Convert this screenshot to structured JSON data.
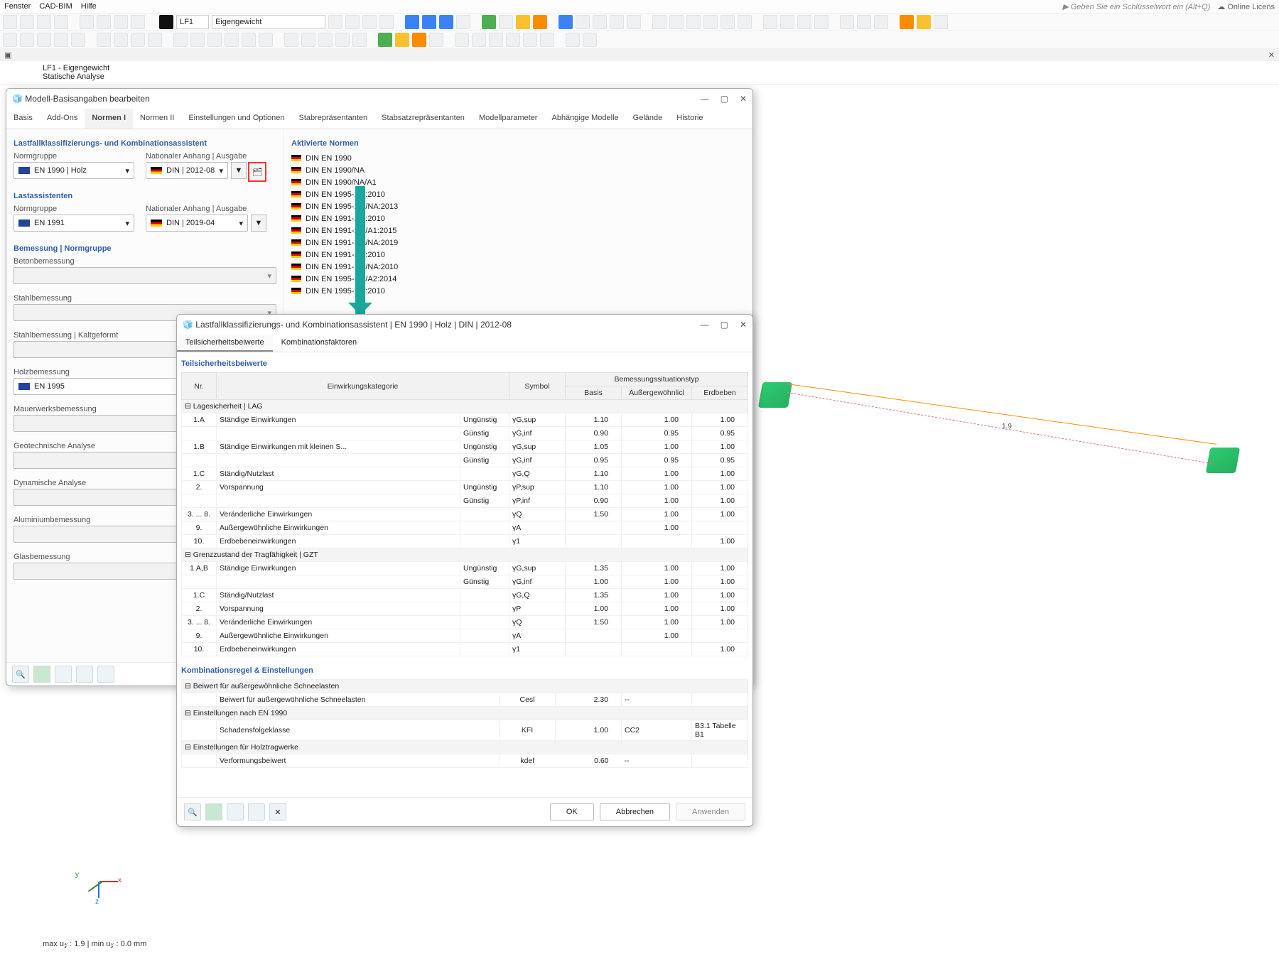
{
  "menu": {
    "items": [
      "Fenster",
      "CAD-BIM",
      "Hilfe"
    ],
    "search_placeholder": "Geben Sie ein Schlüsselwort ein (Alt+Q)",
    "license": "Online Licens"
  },
  "lf": {
    "code": "LF1",
    "name": "Eigengewicht"
  },
  "header": {
    "line1": "LF1 - Eigengewicht",
    "line2": "Statische Analyse"
  },
  "viewport": {
    "dim_label": "1.9",
    "axes": {
      "x": "x",
      "y": "y",
      "z": "z"
    },
    "uz_text": "max u",
    "uz_sub": "z",
    "uz_vals": " : 1.9 | min u",
    " uz_sub2": "z",
    "uz_tail": " : 0.0 mm"
  },
  "dlg1": {
    "title": "Modell-Basisangaben bearbeiten",
    "tabs": [
      "Basis",
      "Add-Ons",
      "Normen I",
      "Normen II",
      "Einstellungen und Optionen",
      "Stabrepräsentanten",
      "Stabsatzrepräsentanten",
      "Modellparameter",
      "Abhängige Modelle",
      "Gelände",
      "Historie"
    ],
    "sect_lk": "Lastfallklassifizierungs- und Kombinationsassistent",
    "lbl_ng": "Normgruppe",
    "lbl_na": "Nationaler Anhang | Ausgabe",
    "ng1": "EN 1990 | Holz",
    "na1": "DIN | 2012-08",
    "sect_la": "Lastassistenten",
    "ng2": "EN 1991",
    "na2": "DIN | 2019-04",
    "sect_bem": "Bemessung | Normgruppe",
    "bem_items": [
      "Betonbemessung",
      "Stahlbemessung",
      "Stahlbemessung | Kaltgeformt",
      "Holzbemessung",
      "Mauerwerksbemessung",
      "Geotechnische Analyse",
      "Dynamische Analyse",
      "Aluminiumbemessung",
      "Glasbemessung"
    ],
    "bem_holz": "EN 1995",
    "sect_norms": "Aktivierte Normen",
    "norms": [
      "DIN EN 1990",
      "DIN EN 1990/NA",
      "DIN EN 1990/NA/A1",
      "DIN EN 1995-1-1:2010",
      "DIN EN 1995-1-1/NA:2013",
      "DIN EN 1991-1-3:2010",
      "DIN EN 1991-1-3/A1:2015",
      "DIN EN 1991-1-3/NA:2019",
      "DIN EN 1991-1-4:2010",
      "DIN EN 1991-1-4/NA:2010",
      "DIN EN 1995-1-1/A2:2014",
      "DIN EN 1995-1-2:2010"
    ]
  },
  "dlg2": {
    "title": "Lastfallklassifizierungs- und Kombinationsassistent | EN 1990 | Holz | DIN | 2012-08",
    "tabs": [
      "Teilsicherheitsbeiwerte",
      "Kombinationsfaktoren"
    ],
    "thdr": "Teilsicherheitsbeiwerte",
    "col": {
      "nr": "Nr.",
      "kat": "Einwirkungskategorie",
      "sym": "Symbol",
      "basis": "Basis",
      "au": "Außergewöhnlicl",
      "eb": "Erdbeben",
      "situ": "Bemessungssituationstyp"
    },
    "grp1": "Lagesicherheit | LAG",
    "rows1": [
      {
        "nr": "1.A",
        "kat": "Ständige Einwirkungen",
        "g": "Ungünstig",
        "sym": "γG,sup",
        "b": "1.10",
        "a": "1.00",
        "e": "1.00"
      },
      {
        "nr": "",
        "kat": "",
        "g": "Günstig",
        "sym": "γG,inf",
        "b": "0.90",
        "a": "0.95",
        "e": "0.95"
      },
      {
        "nr": "1.B",
        "kat": "Ständige Einwirkungen mit kleinen S...",
        "g": "Ungünstig",
        "sym": "γG,sup",
        "b": "1.05",
        "a": "1.00",
        "e": "1.00"
      },
      {
        "nr": "",
        "kat": "",
        "g": "Günstig",
        "sym": "γG,inf",
        "b": "0.95",
        "a": "0.95",
        "e": "0.95"
      },
      {
        "nr": "1.C",
        "kat": "Ständig/Nutzlast",
        "g": "",
        "sym": "γG,Q",
        "b": "1.10",
        "a": "1.00",
        "e": "1.00"
      },
      {
        "nr": "2.",
        "kat": "Vorspannung",
        "g": "Ungünstig",
        "sym": "γP,sup",
        "b": "1.10",
        "a": "1.00",
        "e": "1.00"
      },
      {
        "nr": "",
        "kat": "",
        "g": "Günstig",
        "sym": "γP,inf",
        "b": "0.90",
        "a": "1.00",
        "e": "1.00"
      },
      {
        "nr": "3. ... 8.",
        "kat": "Veränderliche Einwirkungen",
        "g": "",
        "sym": "γQ",
        "b": "1.50",
        "a": "1.00",
        "e": "1.00"
      },
      {
        "nr": "9.",
        "kat": "Außergewöhnliche Einwirkungen",
        "g": "",
        "sym": "γA",
        "b": "",
        "a": "1.00",
        "e": ""
      },
      {
        "nr": "10.",
        "kat": "Erdbebeneinwirkungen",
        "g": "",
        "sym": "γ1",
        "b": "",
        "a": "",
        "e": "1.00"
      }
    ],
    "grp2": "Grenzzustand der Tragfähigkeit | GZT",
    "rows2": [
      {
        "nr": "1.A,B",
        "kat": "Ständige Einwirkungen",
        "g": "Ungünstig",
        "sym": "γG,sup",
        "b": "1.35",
        "a": "1.00",
        "e": "1.00"
      },
      {
        "nr": "",
        "kat": "",
        "g": "Günstig",
        "sym": "γG,inf",
        "b": "1.00",
        "a": "1.00",
        "e": "1.00"
      },
      {
        "nr": "1.C",
        "kat": "Ständig/Nutzlast",
        "g": "",
        "sym": "γG,Q",
        "b": "1.35",
        "a": "1.00",
        "e": "1.00"
      },
      {
        "nr": "2.",
        "kat": "Vorspannung",
        "g": "",
        "sym": "γP",
        "b": "1.00",
        "a": "1.00",
        "e": "1.00"
      },
      {
        "nr": "3. ... 8.",
        "kat": "Veränderliche Einwirkungen",
        "g": "",
        "sym": "γQ",
        "b": "1.50",
        "a": "1.00",
        "e": "1.00"
      },
      {
        "nr": "9.",
        "kat": "Außergewöhnliche Einwirkungen",
        "g": "",
        "sym": "γA",
        "b": "",
        "a": "1.00",
        "e": ""
      },
      {
        "nr": "10.",
        "kat": "Erdbebeneinwirkungen",
        "g": "",
        "sym": "γ1",
        "b": "",
        "a": "",
        "e": "1.00"
      }
    ],
    "sect_komb": "Kombinationsregel & Einstellungen",
    "grp3": "Beiwert für außergewöhnliche Schneelasten",
    "r3": {
      "kat": "Beiwert für außergewöhnliche Schneelasten",
      "sym": "Cesl",
      "b": "2.30",
      "a": "--"
    },
    "grp4": "Einstellungen nach EN 1990",
    "r4": {
      "kat": "Schadensfolgeklasse",
      "sym": "KFI",
      "b": "1.00",
      "a": "CC2",
      "e": "B3.1 Tabelle B1"
    },
    "grp5": "Einstellungen für Holztragwerke",
    "r5": {
      "kat": "Verformungsbeiwert",
      "sym": "kdef",
      "b": "0.60",
      "a": "--"
    },
    "btn_ok": "OK",
    "btn_cancel": "Abbrechen",
    "btn_apply": "Anwenden"
  },
  "status": "max u𝓏 : 1.9 | min u𝓏 : 0.0 mm"
}
